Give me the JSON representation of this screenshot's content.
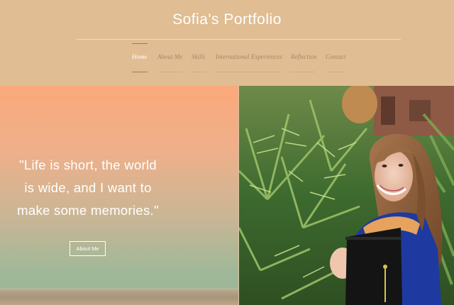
{
  "header": {
    "title": "Sofia's Portfolio"
  },
  "nav": {
    "items": [
      {
        "label": "Home",
        "active": true
      },
      {
        "label": "About Me",
        "active": false
      },
      {
        "label": "Skills",
        "active": false
      },
      {
        "label": "International Experiences",
        "active": false
      },
      {
        "label": "Reflection",
        "active": false
      },
      {
        "label": "Contact",
        "active": false
      }
    ]
  },
  "hero": {
    "quote_lines": [
      "\"Life is short, the world",
      "is wide, and I want to",
      "make some memories.\""
    ],
    "button_label": "About Me"
  },
  "colors": {
    "header_bg": "#e0bd92",
    "nav_text": "#a58a6c",
    "active_nav": "#ffffff"
  }
}
